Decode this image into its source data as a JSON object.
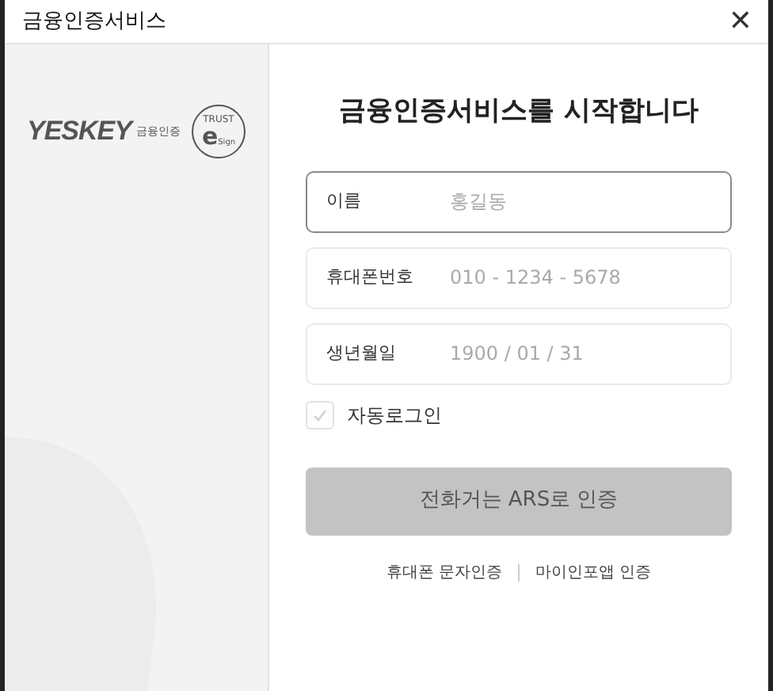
{
  "window": {
    "title": "금융인증서비스",
    "close": "✕"
  },
  "logo": {
    "brand": "YESKEY",
    "subtitle": "금융인증",
    "badge_top": "TRUST",
    "badge_letter": "e",
    "badge_bottom": "Sign"
  },
  "heading": "금융인증서비스를 시작합니다",
  "fields": [
    {
      "label": "이름",
      "placeholder": "홍길동",
      "focused": true
    },
    {
      "label": "휴대폰번호",
      "placeholder": "010 - 1234 - 5678",
      "focused": false
    },
    {
      "label": "생년월일",
      "placeholder": "1900 / 01 / 31",
      "focused": false
    }
  ],
  "auto_login": {
    "label": "자동로그인",
    "checked": false
  },
  "submit": {
    "label": "전화거는 ARS로 인증",
    "disabled": true
  },
  "links": [
    "휴대폰 문자인증",
    "마이인포앱 인증"
  ]
}
